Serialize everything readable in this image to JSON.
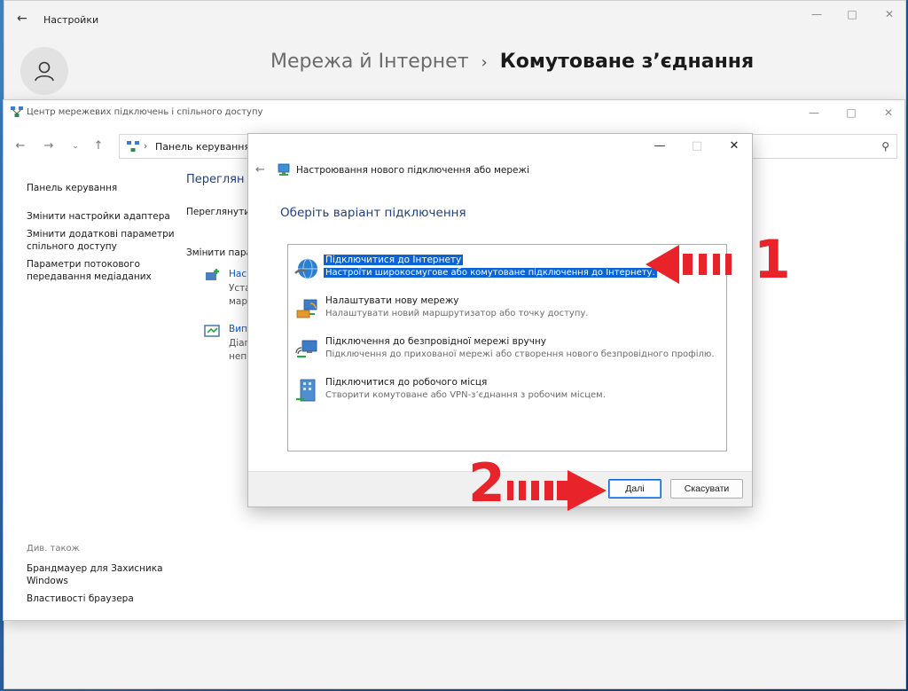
{
  "settings": {
    "title": "Настройки",
    "breadcrumb_parent": "Мережа й Інтернет",
    "breadcrumb_sep": "›",
    "breadcrumb_current": "Комутоване з’єднання"
  },
  "network_center": {
    "title": "Центр мережевих підключень і спільного доступу",
    "address": "Панель керування",
    "address_sep": "›",
    "sidebar": [
      "Панель керування",
      "Змінити настройки адаптера",
      "Змінити додаткові параметри спільного доступу",
      "Параметри потокового передавання медіаданих"
    ],
    "see_also_heading": "Див. також",
    "see_also": [
      "Брандмауер для Захисника Windows",
      "Властивості браузера"
    ],
    "main_peek": {
      "heading": "Переглян",
      "line1": "Переглянути",
      "line2": "Змінити пара",
      "item1_link": "Нас",
      "item1_sub1": "Уста",
      "item1_sub2": "мар",
      "item2_link": "Вип",
      "item2_sub1": "Діаг",
      "item2_sub2": "неп"
    }
  },
  "dialog": {
    "title": "Настроювання нового підключення або мережі",
    "heading": "Оберіть варіант підключення",
    "options": [
      {
        "title": "Підключитися до Інтернету",
        "desc": "Настроїти широкосмугове або комутоване підключення до Інтернету.",
        "selected": true,
        "icon": "globe-icon"
      },
      {
        "title": "Налаштувати нову мережу",
        "desc": "Налаштувати новий маршрутизатор або точку доступу.",
        "selected": false,
        "icon": "router-icon"
      },
      {
        "title": "Підключення до безпровідної мережі вручну",
        "desc": "Підключення до прихованої мережі або створення нового безпровідного профілю.",
        "selected": false,
        "icon": "wireless-icon"
      },
      {
        "title": "Підключитися до робочого місця",
        "desc": "Створити комутоване або VPN-з’єднання з робочим місцем.",
        "selected": false,
        "icon": "workplace-icon"
      }
    ],
    "next_label": "Далі",
    "cancel_label": "Скасувати"
  },
  "annotations": {
    "step1": "1",
    "step2": "2",
    "color": "#e8232a"
  },
  "colors": {
    "selection": "#0a64d6",
    "link_heading": "#1e3f8a"
  }
}
